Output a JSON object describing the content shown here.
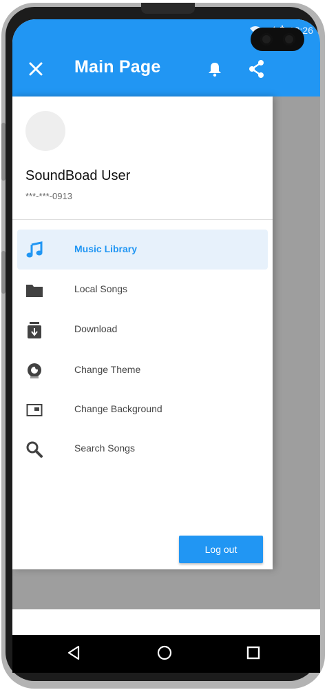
{
  "status_bar": {
    "time": "12:26"
  },
  "appbar": {
    "title": "Main Page",
    "close_icon": "close-icon",
    "bell_icon": "bell-icon",
    "share_icon": "share-icon"
  },
  "user": {
    "name": "SoundBoad User",
    "phone": "***-***-0913"
  },
  "drawer": {
    "items": [
      {
        "label": "Music Library",
        "icon": "music-note-icon",
        "active": true
      },
      {
        "label": "Local Songs",
        "icon": "folder-icon",
        "active": false
      },
      {
        "label": "Download",
        "icon": "download-icon",
        "active": false
      },
      {
        "label": "Change Theme",
        "icon": "theme-icon",
        "active": false
      },
      {
        "label": "Change Background",
        "icon": "background-icon",
        "active": false
      },
      {
        "label": "Search Songs",
        "icon": "search-icon",
        "active": false
      }
    ],
    "logout_label": "Log out"
  },
  "colors": {
    "accent": "#2196f3",
    "active_bg": "#e7f1fb",
    "scrim": "#9e9e9e"
  }
}
